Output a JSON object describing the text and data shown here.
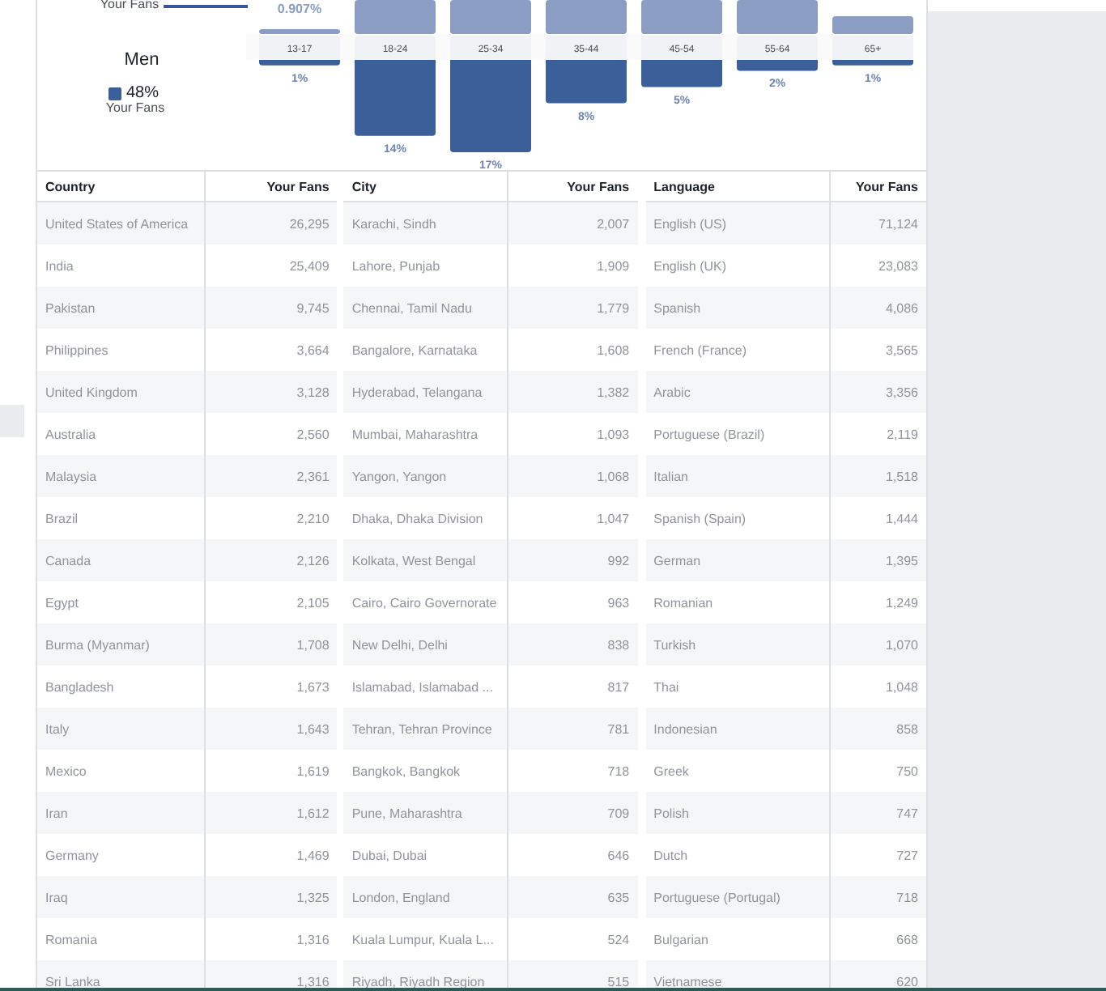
{
  "top_cut_texts": {
    "caption": "Your Fans",
    "women_value": "0.907%"
  },
  "men": {
    "label": "Men",
    "share": "48%",
    "caption": "Your Fans",
    "color": "#3b5f98",
    "age_groups": [
      {
        "age": "13-17",
        "share": "1%"
      },
      {
        "age": "18-24",
        "share": "14%"
      },
      {
        "age": "25-34",
        "share": "17%"
      },
      {
        "age": "35-44",
        "share": "8%"
      },
      {
        "age": "45-54",
        "share": "5%"
      },
      {
        "age": "55-64",
        "share": "2%"
      },
      {
        "age": "65+",
        "share": "1%"
      }
    ]
  },
  "tables": [
    {
      "columns": [
        "Country",
        "Your Fans"
      ],
      "rows": [
        [
          "United States of America",
          "26,295"
        ],
        [
          "India",
          "25,409"
        ],
        [
          "Pakistan",
          "9,745"
        ],
        [
          "Philippines",
          "3,664"
        ],
        [
          "United Kingdom",
          "3,128"
        ],
        [
          "Australia",
          "2,560"
        ],
        [
          "Malaysia",
          "2,361"
        ],
        [
          "Brazil",
          "2,210"
        ],
        [
          "Canada",
          "2,126"
        ],
        [
          "Egypt",
          "2,105"
        ],
        [
          "Burma (Myanmar)",
          "1,708"
        ],
        [
          "Bangladesh",
          "1,673"
        ],
        [
          "Italy",
          "1,643"
        ],
        [
          "Mexico",
          "1,619"
        ],
        [
          "Iran",
          "1,612"
        ],
        [
          "Germany",
          "1,469"
        ],
        [
          "Iraq",
          "1,325"
        ],
        [
          "Romania",
          "1,316"
        ],
        [
          "Sri Lanka",
          "1,316"
        ]
      ]
    },
    {
      "columns": [
        "City",
        "Your Fans"
      ],
      "rows": [
        [
          "Karachi, Sindh",
          "2,007"
        ],
        [
          "Lahore, Punjab",
          "1,909"
        ],
        [
          "Chennai, Tamil Nadu",
          "1,779"
        ],
        [
          "Bangalore, Karnataka",
          "1,608"
        ],
        [
          "Hyderabad, Telangana",
          "1,382"
        ],
        [
          "Mumbai, Maharashtra",
          "1,093"
        ],
        [
          "Yangon, Yangon",
          "1,068"
        ],
        [
          "Dhaka, Dhaka Division",
          "1,047"
        ],
        [
          "Kolkata, West Bengal",
          "992"
        ],
        [
          "Cairo, Cairo Governorate",
          "963"
        ],
        [
          "New Delhi, Delhi",
          "838"
        ],
        [
          "Islamabad, Islamabad ...",
          "817"
        ],
        [
          "Tehran, Tehran Province",
          "781"
        ],
        [
          "Bangkok, Bangkok",
          "718"
        ],
        [
          "Pune, Maharashtra",
          "709"
        ],
        [
          "Dubai, Dubai",
          "646"
        ],
        [
          "London, England",
          "635"
        ],
        [
          "Kuala Lumpur, Kuala L...",
          "524"
        ],
        [
          "Riyadh, Riyadh Region",
          "515"
        ]
      ]
    },
    {
      "columns": [
        "Language",
        "Your Fans"
      ],
      "rows": [
        [
          "English (US)",
          "71,124"
        ],
        [
          "English (UK)",
          "23,083"
        ],
        [
          "Spanish",
          "4,086"
        ],
        [
          "French (France)",
          "3,565"
        ],
        [
          "Arabic",
          "3,356"
        ],
        [
          "Portuguese (Brazil)",
          "2,119"
        ],
        [
          "Italian",
          "1,518"
        ],
        [
          "Spanish (Spain)",
          "1,444"
        ],
        [
          "German",
          "1,395"
        ],
        [
          "Romanian",
          "1,249"
        ],
        [
          "Turkish",
          "1,070"
        ],
        [
          "Thai",
          "1,048"
        ],
        [
          "Indonesian",
          "858"
        ],
        [
          "Greek",
          "750"
        ],
        [
          "Polish",
          "747"
        ],
        [
          "Dutch",
          "727"
        ],
        [
          "Portuguese (Portugal)",
          "718"
        ],
        [
          "Bulgarian",
          "668"
        ],
        [
          "Vietnamese",
          "620"
        ]
      ]
    }
  ]
}
